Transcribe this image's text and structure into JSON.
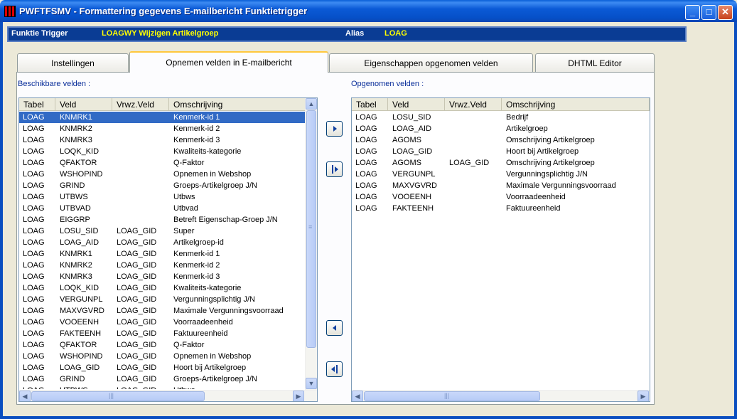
{
  "window": {
    "title": "PWFTFSMV - Formattering gegevens E-mailbericht Funktietrigger",
    "controls": [
      "minimize-icon",
      "maximize-icon",
      "close-icon"
    ]
  },
  "infobar": {
    "funktie_label": "Funktie Trigger",
    "funktie_value": "LOAGWY  Wijzigen Artikelgroep",
    "alias_label": "Alias",
    "alias_value": "LOAG"
  },
  "tabs": [
    {
      "label": "Instellingen"
    },
    {
      "label": "Opnemen velden in E-mailbericht"
    },
    {
      "label": "Eigenschappen opgenomen velden"
    },
    {
      "label": "DHTML Editor"
    }
  ],
  "available": {
    "label": "Beschikbare velden :",
    "columns": [
      "Tabel",
      "Veld",
      "Vrwz.Veld",
      "Omschrijving"
    ],
    "rows": [
      [
        "LOAG",
        "KNMRK1",
        "",
        "Kenmerk-id 1"
      ],
      [
        "LOAG",
        "KNMRK2",
        "",
        "Kenmerk-id 2"
      ],
      [
        "LOAG",
        "KNMRK3",
        "",
        "Kenmerk-id 3"
      ],
      [
        "LOAG",
        "LOQK_KID",
        "",
        "Kwaliteits-kategorie"
      ],
      [
        "LOAG",
        "QFAKTOR",
        "",
        "Q-Faktor"
      ],
      [
        "LOAG",
        "WSHOPIND",
        "",
        "Opnemen in Webshop"
      ],
      [
        "LOAG",
        "GRIND",
        "",
        "Groeps-Artikelgroep J/N"
      ],
      [
        "LOAG",
        "UTBWS",
        "",
        "Utbws"
      ],
      [
        "LOAG",
        "UTBVAD",
        "",
        "Utbvad"
      ],
      [
        "LOAG",
        "EIGGRP",
        "",
        "Betreft Eigenschap-Groep J/N"
      ],
      [
        "LOAG",
        "LOSU_SID",
        "LOAG_GID",
        "Super"
      ],
      [
        "LOAG",
        "LOAG_AID",
        "LOAG_GID",
        "Artikelgroep-id"
      ],
      [
        "LOAG",
        "KNMRK1",
        "LOAG_GID",
        "Kenmerk-id 1"
      ],
      [
        "LOAG",
        "KNMRK2",
        "LOAG_GID",
        "Kenmerk-id 2"
      ],
      [
        "LOAG",
        "KNMRK3",
        "LOAG_GID",
        "Kenmerk-id 3"
      ],
      [
        "LOAG",
        "LOQK_KID",
        "LOAG_GID",
        "Kwaliteits-kategorie"
      ],
      [
        "LOAG",
        "VERGUNPL",
        "LOAG_GID",
        "Vergunningsplichtig J/N"
      ],
      [
        "LOAG",
        "MAXVGVRD",
        "LOAG_GID",
        "Maximale Vergunningsvoorraad"
      ],
      [
        "LOAG",
        "VOOEENH",
        "LOAG_GID",
        "Voorraadeenheid"
      ],
      [
        "LOAG",
        "FAKTEENH",
        "LOAG_GID",
        "Faktuureenheid"
      ],
      [
        "LOAG",
        "QFAKTOR",
        "LOAG_GID",
        "Q-Faktor"
      ],
      [
        "LOAG",
        "WSHOPIND",
        "LOAG_GID",
        "Opnemen in Webshop"
      ],
      [
        "LOAG",
        "LOAG_GID",
        "LOAG_GID",
        "Hoort bij Artikelgroep"
      ],
      [
        "LOAG",
        "GRIND",
        "LOAG_GID",
        "Groeps-Artikelgroep J/N"
      ],
      [
        "LOAG",
        "UTBWS",
        "LOAG_GID",
        "Utbws"
      ]
    ]
  },
  "selected": {
    "label": "Opgenomen velden :",
    "columns": [
      "Tabel",
      "Veld",
      "Vrwz.Veld",
      "Omschrijving"
    ],
    "rows": [
      [
        "LOAG",
        "LOSU_SID",
        "",
        "Bedrijf"
      ],
      [
        "LOAG",
        "LOAG_AID",
        "",
        "Artikelgroep"
      ],
      [
        "LOAG",
        "AGOMS",
        "",
        "Omschrijving Artikelgroep"
      ],
      [
        "LOAG",
        "LOAG_GID",
        "",
        "Hoort bij Artikelgroep"
      ],
      [
        "LOAG",
        "AGOMS",
        "LOAG_GID",
        "Omschrijving Artikelgroep"
      ],
      [
        "LOAG",
        "VERGUNPL",
        "",
        "Vergunningsplichtig J/N"
      ],
      [
        "LOAG",
        "MAXVGVRD",
        "",
        "Maximale Vergunningsvoorraad"
      ],
      [
        "LOAG",
        "VOOEENH",
        "",
        "Voorraadeenheid"
      ],
      [
        "LOAG",
        "FAKTEENH",
        "",
        "Faktuureenheid"
      ]
    ]
  },
  "move_buttons": [
    "add-one-icon",
    "add-all-icon",
    "remove-one-icon",
    "remove-all-icon"
  ]
}
